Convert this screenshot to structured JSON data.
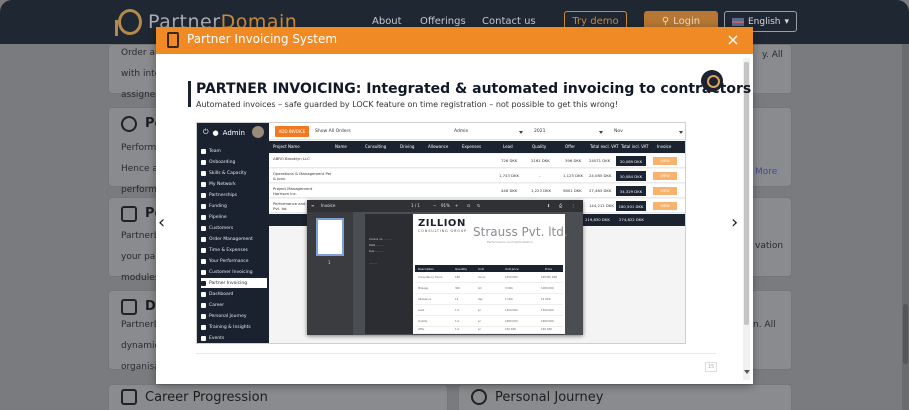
{
  "site": {
    "logo_left": "Partner",
    "logo_right": "Domain",
    "nav": [
      "About",
      "Offerings",
      "Contact us"
    ],
    "try_demo": "Try demo",
    "login": "Login",
    "language": "English",
    "cards": {
      "left_top_lines": [
        "Order an",
        "with integ",
        "assigned"
      ],
      "right_top_text": "y. All",
      "card2_title": "Pe",
      "card2_lines": [
        "Performa",
        "Hence al",
        "performa"
      ],
      "card2_right": "More",
      "card3_title": "Po",
      "card3_lines": [
        "PartnerD",
        "your par",
        "modules."
      ],
      "card3_right": "vation",
      "card4_title": "Do",
      "card4_lines": [
        "PartnerD",
        "dynamic",
        "organisa"
      ],
      "card4_right": "n. All",
      "card5_title": "Career Progression",
      "card6_title": "Personal Journey"
    }
  },
  "modal": {
    "title": "Partner Invoicing System",
    "close": "×",
    "prev_arrow": "‹",
    "next_arrow": "›",
    "headline": "PARTNER INVOICING: Integrated & automated invoicing to contractors",
    "subheadline": "Automated invoices – safe guarded by LOCK feature on time registration – not possible to get this wrong!",
    "page_badge": "15"
  },
  "app": {
    "admin": "Admin",
    "sidebar": [
      "Team",
      "Onboarding",
      "Skills & Capacity",
      "My Network",
      "Partnerships",
      "Funding",
      "Pipeline",
      "Customers",
      "Order Management",
      "Time & Expenses",
      "Your Performance",
      "Customer Invoicing",
      "Partner Invoicing",
      "Dashboard",
      "Career",
      "Personal Journey",
      "Training & Insights",
      "Events"
    ],
    "add_button": "ADD INVOICE",
    "show_all": "Show All Orders",
    "filters": [
      "Admin",
      "2021",
      "Nov"
    ],
    "columns": [
      "Project Name",
      "Name",
      "Consulting",
      "Driving",
      "Allowance",
      "Expenses",
      "Lead",
      "Quality",
      "Offer",
      "Total excl. VAT",
      "Total incl. VAT",
      "Invoice"
    ],
    "rows": [
      {
        "project": "ABRO Brooklyn LLC",
        "lead": "726 DKK",
        "quality": "2161 DKK",
        "offer": "396 DKK",
        "excl": "24071 DKK",
        "incl": "30,089 DKK",
        "action": "VIEW"
      },
      {
        "project": "Operations & Management Per & Jonn",
        "lead": "1,743 DKK",
        "quality": "-",
        "offer": "1,125 DKK",
        "excl": "24,085 DKK",
        "incl": "30,084 DKK",
        "action": "VIEW"
      },
      {
        "project": "Project Management Harrison Inc.",
        "lead": "446 DKK",
        "quality": "1,223 DKK",
        "offer": "5801 DKK",
        "excl": "27,463 DKK",
        "incl": "34,329 DKK",
        "action": "VIEW"
      },
      {
        "project": "Performance and Strauss Pvt. ltd.",
        "lead": "",
        "quality": "",
        "offer": "",
        "excl": "144,211 DKK",
        "incl": "180,501 DKK",
        "action": "VIEW"
      }
    ],
    "totals": {
      "label": "DKK",
      "excl": "219,830 DKK",
      "incl": "274,822 DKK"
    }
  },
  "pdf": {
    "title": "Invoice",
    "page_info": "1 / 1",
    "zoom": "91%",
    "brand": "ZILLION",
    "brand_sub": "CONSULTING GROUP",
    "company": "Strauss Pvt. ltd.",
    "company_sub": "Performance and Optimization",
    "table_head": [
      "Description",
      "Quantity",
      "Unit",
      "Unit price",
      "Price"
    ],
    "rows": [
      {
        "desc": "Consultancy Hours",
        "qty": "186",
        "unit": "hours",
        "price": "1050 DKK",
        "total": "195300 DKK"
      },
      {
        "desc": "Mileage",
        "qty": "360",
        "unit": "km",
        "price": "3 DKK",
        "total": "1080 DKK"
      },
      {
        "desc": "Allowance",
        "qty": "12",
        "unit": "day",
        "price": "1 DKK",
        "total": "12 DKK"
      },
      {
        "desc": "Lead",
        "qty": "1.0",
        "unit": "pc",
        "price": "1300 DKK",
        "total": "1300 DKK"
      },
      {
        "desc": "Quality",
        "qty": "1.0",
        "unit": "pc",
        "price": "1680 DKK",
        "total": "1680 DKK"
      },
      {
        "desc": "Offer",
        "qty": "1.0",
        "unit": "pc",
        "price": "150 DKK",
        "total": "150 DKK"
      }
    ]
  }
}
